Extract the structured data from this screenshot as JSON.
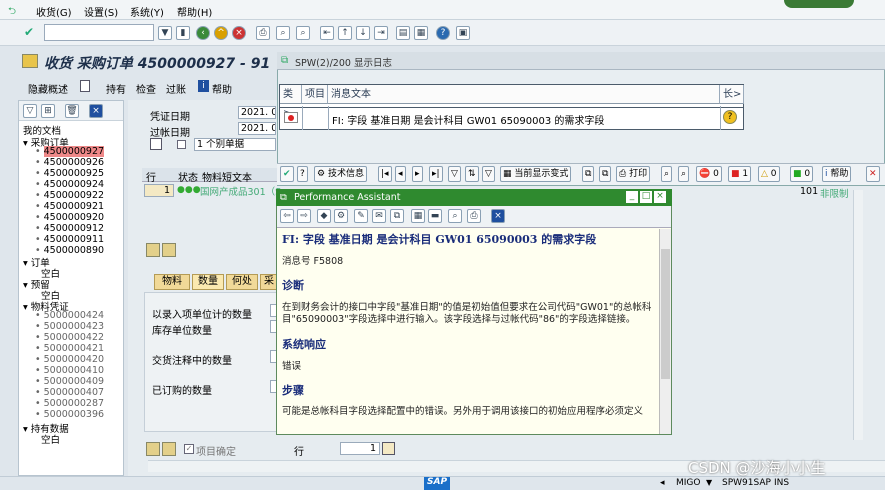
{
  "menu": [
    "收货(G)",
    "设置(S)",
    "系统(Y)",
    "帮助(H)"
  ],
  "app": {
    "title": "收货 采购订单 4500000927 - 91",
    "toolbar": [
      "隐藏概述",
      "持有",
      "检查",
      "过账",
      "帮助"
    ]
  },
  "nav": {
    "header": "我的文档",
    "purchase_orders_label": "采购订单",
    "purchase_orders": [
      "4500000927",
      "4500000926",
      "4500000925",
      "4500000924",
      "4500000922",
      "4500000921",
      "4500000920",
      "4500000912",
      "4500000911",
      "4500000890"
    ],
    "orders_label": "订单",
    "empty": "空白",
    "reservations_label": "预留",
    "material_docs_label": "物料凭证",
    "material_docs": [
      "5000000424",
      "5000000423",
      "5000000422",
      "5000000421",
      "5000000420",
      "5000000410",
      "5000000409",
      "5000000407",
      "5000000287",
      "5000000396"
    ],
    "held_label": "持有数据"
  },
  "main": {
    "doc_date_label": "凭证日期",
    "doc_date": "2021. 0",
    "post_date_label": "过帐日期",
    "post_date": "2021. 0",
    "slip_select": "1 个别单据",
    "cols": [
      "行",
      "状态",
      "物料短文本"
    ],
    "row_no": "1",
    "row_text": "国网产成品301（S",
    "tabs": [
      "物料",
      "数量",
      "何处",
      "采"
    ],
    "qty_labels": [
      "以录入项单位计的数量",
      "库存单位数量",
      "交货注释中的数量",
      "已订购的数量"
    ],
    "item_ok_label": "项目确定",
    "row_label": "行",
    "row_value": "1",
    "right_value": "101",
    "right_text": "非限制"
  },
  "spw": {
    "title": "SPW(2)/200 显示日志",
    "headers": [
      "类>",
      "项目",
      "消息文本",
      "长>"
    ],
    "message": "FI: 字段 基准日期 是会计科目 GW01 65090003 的需求字段",
    "buttons": [
      "技术信息",
      "当前显示变式",
      "打印",
      "0",
      "1",
      "0",
      "0",
      "帮助"
    ]
  },
  "pa": {
    "title": "Performance Assistant",
    "heading": "FI: 字段 基准日期 是会计科目 GW01 65090003 的需求字段",
    "msgno": "消息号 F5808",
    "diag_label": "诊断",
    "diag_text": "在到财务会计的接口中字段\"基准日期\"的值是初始值但要求在公司代码\"GW01\"的总帐科目\"65090003\"字段选择中进行输入。该字段选择与过帐代码\"86\"的字段选择链接。",
    "sysresp_label": "系统响应",
    "sysresp_text": "错误",
    "steps_label": "步骤",
    "steps_text": "可能是总帐科目字段选择配置中的错误。另外用于调用该接口的初始应用程序必须定义"
  },
  "status": {
    "sap": "SAP",
    "tcode": "MIGO",
    "server": "SPW91SAP",
    "mode": "INS"
  },
  "watermark": "CSDN @沙海小小生"
}
